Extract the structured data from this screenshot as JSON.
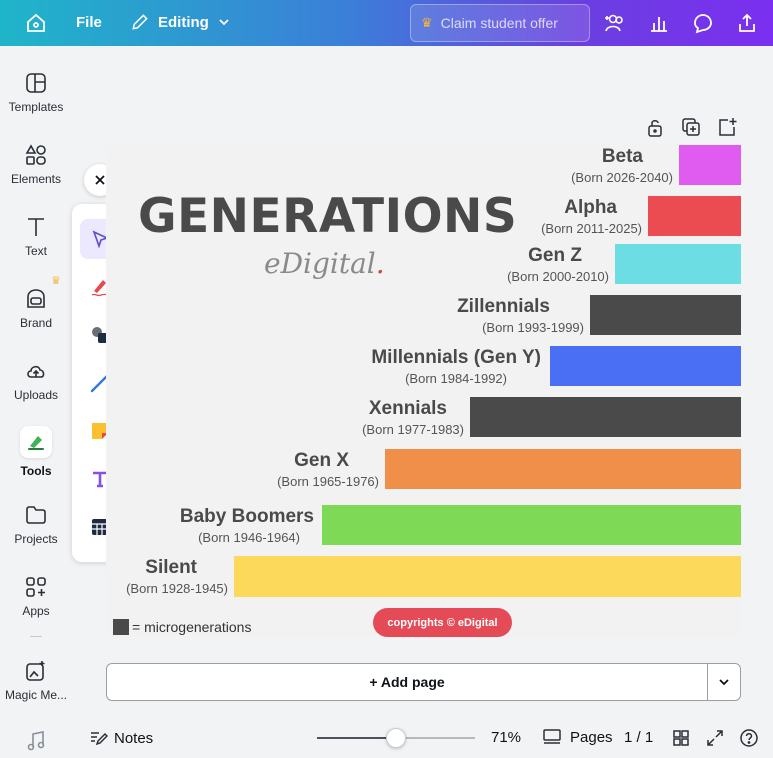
{
  "topbar": {
    "file_label": "File",
    "editing_label": "Editing",
    "claim_label": "Claim student offer"
  },
  "sidebar": {
    "items": [
      {
        "label": "Templates"
      },
      {
        "label": "Elements"
      },
      {
        "label": "Text"
      },
      {
        "label": "Brand"
      },
      {
        "label": "Uploads"
      },
      {
        "label": "Tools"
      },
      {
        "label": "Projects"
      },
      {
        "label": "Apps"
      },
      {
        "label": "Magic Me..."
      }
    ]
  },
  "canvas": {
    "title": "GENERATIONS",
    "logo_text": "eDigital",
    "legend": "= microgenerations",
    "copyright": "copyrights © eDigital",
    "generations": [
      {
        "name": "Beta",
        "born": "(Born 2026-2040)",
        "color": "#e05cf0"
      },
      {
        "name": "Alpha",
        "born": "(Born 2011-2025)",
        "color": "#ea4c52"
      },
      {
        "name": "Gen Z",
        "born": "(Born 2000-2010)",
        "color": "#6ddde4"
      },
      {
        "name": "Zillennials",
        "born": "(Born 1993-1999)",
        "color": "#4a4a4a"
      },
      {
        "name": "Millennials (Gen Y)",
        "born": "(Born 1984-1992)",
        "color": "#4a6ff5"
      },
      {
        "name": "Xennials",
        "born": "(Born 1977-1983)",
        "color": "#4a4a4a"
      },
      {
        "name": "Gen X",
        "born": "(Born 1965-1976)",
        "color": "#ef8f4a"
      },
      {
        "name": "Baby Boomers",
        "born": "(Born 1946-1964)",
        "color": "#7ed957"
      },
      {
        "name": "Silent",
        "born": "(Born 1928-1945)",
        "color": "#fdd95b"
      }
    ]
  },
  "add_page_label": "+ Add page",
  "bottombar": {
    "notes_label": "Notes",
    "zoom": "71%",
    "pages_label": "Pages",
    "page_count": "1 / 1"
  }
}
